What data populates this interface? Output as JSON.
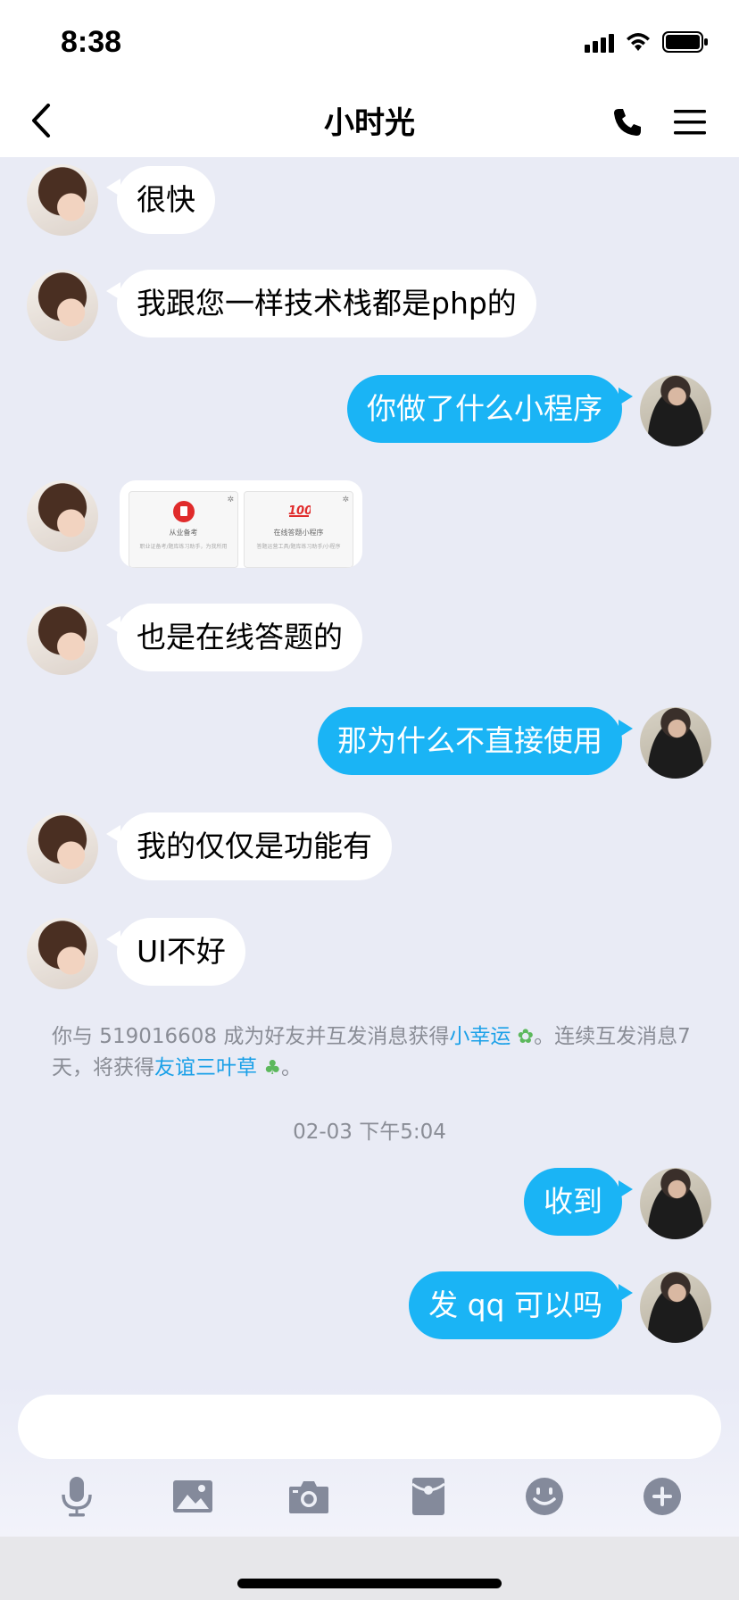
{
  "status_bar": {
    "time": "8:38"
  },
  "header": {
    "title": "小时光"
  },
  "messages": [
    {
      "side": "left",
      "text": "很快"
    },
    {
      "side": "left",
      "text": "我跟您一样技术栈都是php的"
    },
    {
      "side": "right",
      "text": "你做了什么小程序"
    },
    {
      "side": "left",
      "type": "card",
      "previews": [
        {
          "title": "从业备考",
          "desc": "职业证备考/题库练习助手，为我所用"
        },
        {
          "title": "在线答题小程序",
          "desc": "答题运营工具/题库练习助手/小程序"
        }
      ]
    },
    {
      "side": "left",
      "text": "也是在线答题的"
    },
    {
      "side": "right",
      "text": "那为什么不直接使用"
    },
    {
      "side": "left",
      "text": "我的仅仅是功能有"
    },
    {
      "side": "left",
      "text": "UI不好"
    },
    {
      "side": "right",
      "text": "收到"
    },
    {
      "side": "right",
      "text": "发 qq 可以吗"
    }
  ],
  "system_notice": {
    "part1": "你与 519016608 成为好友并互发消息获得",
    "link1": "小幸运",
    "part2": "。连续互发消息7天，将获得",
    "link2": "友谊三叶草",
    "part3": "。"
  },
  "timestamp": "02-03 下午5:04",
  "colors": {
    "sent_bubble": "#1ab4f5",
    "received_bubble": "#ffffff",
    "chat_background": "#e9ebf5",
    "link": "#1aa0e8"
  },
  "toolbar_icons": [
    "microphone-icon",
    "image-icon",
    "camera-icon",
    "red-packet-icon",
    "emoji-icon",
    "plus-icon"
  ]
}
